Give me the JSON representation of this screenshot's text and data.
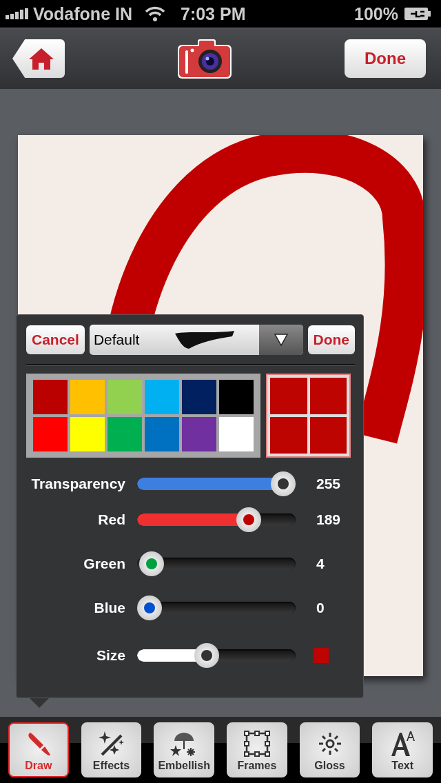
{
  "status_bar": {
    "carrier": "Vodafone IN",
    "time": "7:03 PM",
    "battery": "100%"
  },
  "nav_bar": {
    "done": "Done"
  },
  "brush_panel": {
    "cancel": "Cancel",
    "brush": "Default",
    "done": "Done",
    "palette": [
      {
        "color": "#bb0000"
      },
      {
        "color": "#ffc000"
      },
      {
        "color": "#92d050"
      },
      {
        "color": "#00b0f0"
      },
      {
        "color": "#002060"
      },
      {
        "color": "#000000"
      },
      {
        "color": "#ff0000"
      },
      {
        "color": "#ffff00"
      },
      {
        "color": "#00b050"
      },
      {
        "color": "#0070c0"
      },
      {
        "color": "#7030a0"
      },
      {
        "color": "#ffffff"
      }
    ],
    "sliders": [
      {
        "label": "Transparency",
        "kind": "number",
        "value": "255",
        "level": 1,
        "color": "#3d7fe0"
      },
      {
        "label": "Red",
        "kind": "number",
        "value": "189",
        "level": 0.74,
        "color": "#f03030"
      },
      {
        "label": "Green",
        "kind": "number",
        "value": "4",
        "level": 0.016
      },
      {
        "label": "Blue",
        "kind": "number",
        "value": "0",
        "level": 0
      },
      {
        "label": "Size",
        "kind": "swatch",
        "level": 0.43,
        "color": "#ffffff"
      }
    ]
  },
  "tools": [
    {
      "label": "Draw",
      "selected": true
    },
    {
      "label": "Effects",
      "selected": false
    },
    {
      "label": "Embellish",
      "selected": false
    },
    {
      "label": "Frames",
      "selected": false
    },
    {
      "label": "Gloss",
      "selected": false
    },
    {
      "label": "Text",
      "selected": false
    }
  ]
}
